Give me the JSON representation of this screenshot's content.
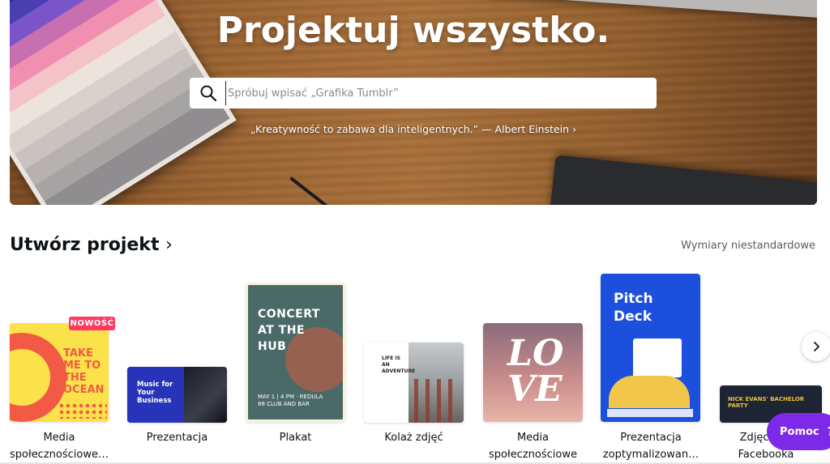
{
  "hero": {
    "title": "Projektuj wszystko.",
    "search_placeholder": "Spróbuj wpisać „Grafika Tumblr”",
    "quote": "„Kreatywność to zabawa dla inteligentnych.” — Albert Einstein ›"
  },
  "section": {
    "title": "Utwórz projekt",
    "title_chevron": "›",
    "custom_size_link": "Wymiary niestandardowe"
  },
  "cards": [
    {
      "label": "Media społecznościowe…",
      "badge": "NOWOŚĆ",
      "preview_text": "TAKE ME TO THE OCEAN"
    },
    {
      "label": "Prezentacja",
      "preview_text": "Music for Your Business"
    },
    {
      "label": "Plakat",
      "preview_text": "CONCERT AT THE HUB",
      "preview_sub": "MAY 1 | 4 PM · REDULA 88 CLUB AND BAR"
    },
    {
      "label": "Kolaż zdjęć",
      "preview_text": "LIFE IS AN ADVENTURE"
    },
    {
      "label": "Media społecznościowe",
      "preview_text": "LOVE"
    },
    {
      "label": "Prezentacja zoptymalizowan…",
      "preview_text": "Pitch Deck"
    },
    {
      "label": "Zdjęcie … Facebooka",
      "preview_text": "NICK EVANS' BACHELOR PARTY"
    }
  ],
  "controls": {
    "next_icon": "chevron-right-icon",
    "help_label": "Pomoc",
    "help_icon_char": "?"
  },
  "colors": {
    "accent": "#7d2ae8",
    "badge": "#ff3a63",
    "text": "#0e1318",
    "muted": "#555b61"
  }
}
